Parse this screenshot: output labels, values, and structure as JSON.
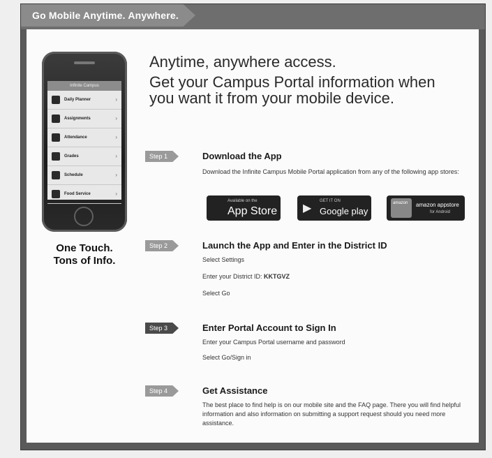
{
  "banner": {
    "title": "Go Mobile Anytime. Anywhere."
  },
  "phone": {
    "header_label": "Infinite Campus",
    "menu": [
      {
        "label": "Daily Planner",
        "icon": "house-icon"
      },
      {
        "label": "Assignments",
        "icon": "books-icon"
      },
      {
        "label": "Attendance",
        "icon": "calendar-icon"
      },
      {
        "label": "Grades",
        "icon": "pencil-icon"
      },
      {
        "label": "Schedule",
        "icon": "schedule-icon"
      },
      {
        "label": "Food Service",
        "icon": "food-icon"
      }
    ],
    "caption_line1": "One Touch.",
    "caption_line2": "Tons of Info."
  },
  "main": {
    "headline_1": "Anytime, anywhere access.",
    "headline_2": "Get your Campus Portal information when you want it from your mobile device."
  },
  "steps": [
    {
      "badge": "Step 1",
      "title": "Download the App",
      "lines": [
        "Download the Infinite Campus Mobile Portal application from any of the following app stores:"
      ]
    },
    {
      "badge": "Step 2",
      "title": "Launch the App and Enter in the District ID",
      "lines": [
        "Select Settings",
        "Enter your District ID:",
        "Select Go"
      ],
      "district_id": "KKTGVZ"
    },
    {
      "badge": "Step 3",
      "title": "Enter Portal Account to Sign In",
      "lines": [
        "Enter your Campus Portal username and password",
        "Select Go/Sign in"
      ]
    },
    {
      "badge": "Step 4",
      "title": "Get Assistance",
      "lines": [
        "The best place to find help is on our mobile site and the FAQ page. There you will find helpful information and also information on submitting a support request should you need more assistance."
      ]
    }
  ],
  "stores": {
    "apple": {
      "small": "Available on the",
      "big": "App Store"
    },
    "google": {
      "small": "GET IT ON",
      "big": "Google play"
    },
    "amazon": {
      "small": "amazon",
      "big": "amazon appstore",
      "sub": "for Android"
    }
  }
}
